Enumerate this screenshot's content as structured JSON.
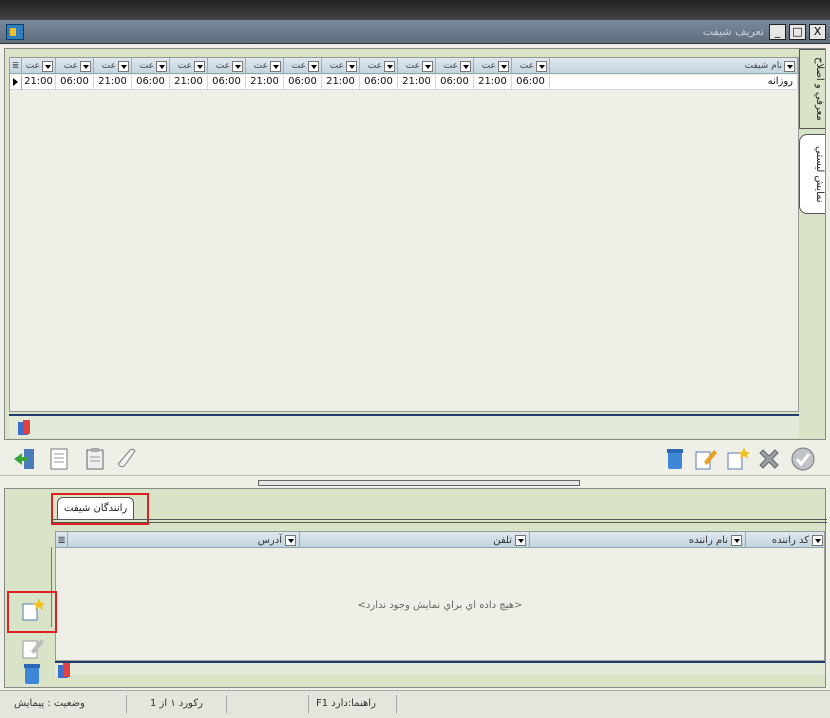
{
  "window": {
    "title": "تعريف شيفت",
    "buttons": {
      "close": "X",
      "maximize": "□",
      "minimize": "_"
    }
  },
  "top_pane": {
    "vertical_tabs": [
      "معرفي و اصلاح",
      "نمايش ليستي"
    ],
    "grid": {
      "name_header": "نام شيفت",
      "time_headers": [
        "عت",
        "عت",
        "عت",
        "عت",
        "عت",
        "عت",
        "عت",
        "عت",
        "عت",
        "عت",
        "عت",
        "عت",
        "عت",
        "عت"
      ],
      "row": {
        "name": "روزانه",
        "times": [
          "21:00",
          "06:00",
          "21:00",
          "06:00",
          "21:00",
          "06:00",
          "21:00",
          "06:00",
          "21:00",
          "06:00",
          "21:00",
          "06:00",
          "21:00",
          "06:00"
        ]
      }
    }
  },
  "toolbar_icons": {
    "left": [
      "export-icon",
      "notepad-icon",
      "clipboard-icon",
      "scroll-icon"
    ],
    "right": [
      "recycle-bin-icon",
      "edit-icon",
      "new-icon",
      "delete-icon",
      "confirm-icon"
    ]
  },
  "bottom_pane": {
    "tab_label": "رانندگان شيفت",
    "columns": {
      "driver_code": "کد راننده",
      "driver_name": "نام راننده",
      "phone": "تلفن",
      "address": "آدرس"
    },
    "empty_message": "<هيچ داده اي براي نمايش وجود ندارد>"
  },
  "status_bar": {
    "status": "وضعيت : پيمايش",
    "record": "رکورد ۱ از 1",
    "help": "راهنما:دارد F1"
  },
  "colors": {
    "highlight": "#e02020",
    "pane": "#d9e3c8",
    "grid_footer_line": "#233a6e"
  }
}
